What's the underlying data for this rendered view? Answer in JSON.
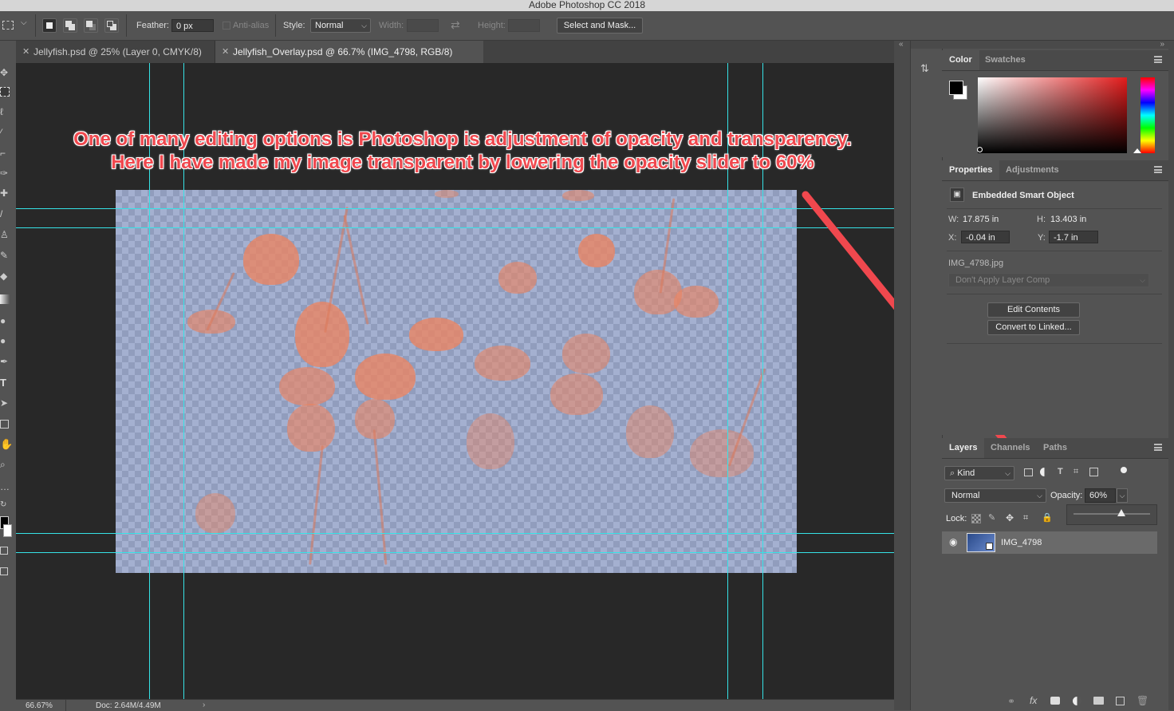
{
  "app": {
    "title": "Adobe Photoshop CC 2018"
  },
  "options": {
    "feather_label": "Feather:",
    "feather_value": "0 px",
    "antialias_label": "Anti-alias",
    "style_label": "Style:",
    "style_value": "Normal",
    "width_label": "Width:",
    "height_label": "Height:",
    "select_mask_label": "Select and Mask..."
  },
  "tabs": [
    {
      "label": "Jellyfish.psd @ 25% (Layer 0, CMYK/8)",
      "active": false
    },
    {
      "label": "Jellyfish_Overlay.psd @ 66.7% (IMG_4798, RGB/8)",
      "active": true
    }
  ],
  "annotation": {
    "line1": "One of many editing options is Photoshop is adjustment of opacity and transparency.",
    "line2": "Here I have made my image transparent by lowering the opacity slider to 60%",
    "color": "#f0484e"
  },
  "status": {
    "zoom": "66.67%",
    "doc": "Doc: 2.64M/4.49M"
  },
  "color_panel": {
    "tabs": [
      "Color",
      "Swatches"
    ],
    "foreground": "#000000",
    "background": "#ffffff",
    "hue": "#e31b1b"
  },
  "properties_panel": {
    "tabs": [
      "Properties",
      "Adjustments"
    ],
    "object_type": "Embedded Smart Object",
    "w_label": "W:",
    "w_value": "17.875 in",
    "h_label": "H:",
    "h_value": "13.403 in",
    "x_label": "X:",
    "x_value": "-0.04 in",
    "y_label": "Y:",
    "y_value": "-1.7 in",
    "filename": "IMG_4798.jpg",
    "layer_comp": "Don't Apply Layer Comp",
    "edit_contents": "Edit Contents",
    "convert_linked": "Convert to Linked..."
  },
  "layers_panel": {
    "tabs": [
      "Layers",
      "Channels",
      "Paths"
    ],
    "kind_label": "Kind",
    "blend_mode": "Normal",
    "opacity_label": "Opacity:",
    "opacity_value": "60%",
    "opacity_fraction": 0.6,
    "lock_label": "Lock:",
    "layers": [
      {
        "name": "IMG_4798",
        "visible": true
      }
    ]
  }
}
